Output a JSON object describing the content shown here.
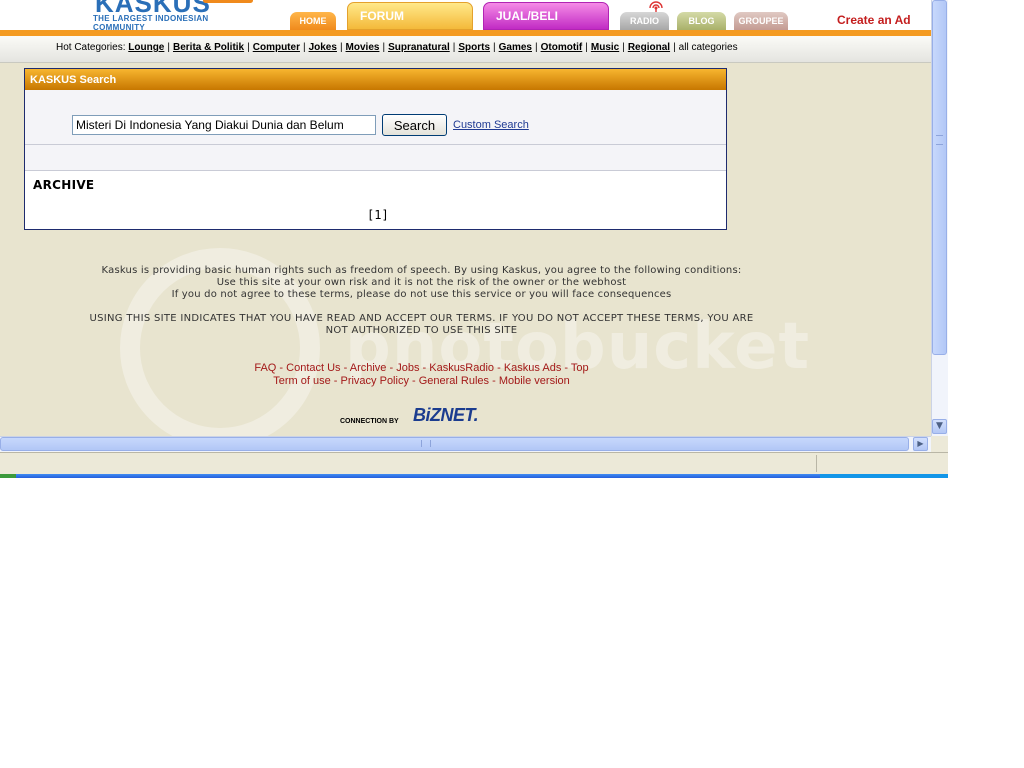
{
  "header": {
    "logo_text": "KASKUS",
    "logo_tagline": "THE LARGEST INDONESIAN COMMUNITY",
    "tabs": [
      {
        "label": "HOME"
      },
      {
        "label": "FORUM"
      },
      {
        "label": "JUAL/BELI"
      },
      {
        "label": "RADIO"
      },
      {
        "label": "BLOG"
      },
      {
        "label": "GROUPEE"
      }
    ],
    "create_ad": "Create an Ad"
  },
  "hot_categories": {
    "label": "Hot Categories:",
    "items": [
      "Lounge",
      "Berita & Politik",
      "Computer",
      "Jokes",
      "Movies",
      "Supranatural",
      "Sports",
      "Games",
      "Otomotif",
      "Music",
      "Regional"
    ],
    "all_label": "all categories"
  },
  "search": {
    "title": "KASKUS Search",
    "query_value": "Misteri Di Indonesia Yang Diakui Dunia dan Belum",
    "button_label": "Search",
    "custom_link": "Custom Search",
    "section_heading": "ARCHIVE",
    "pagination": "[1]"
  },
  "footer": {
    "disclaimer_lines": [
      "Kaskus is providing basic human rights such as freedom of speech. By using Kaskus, you agree to the following conditions:",
      "Use this site at your own risk and it is not the risk of the owner or the webhost",
      "If you do not agree to these terms, please do not use this service or you will face consequences"
    ],
    "terms_lines": [
      "USING THIS SITE INDICATES THAT YOU HAVE READ AND ACCEPT OUR TERMS. IF YOU DO NOT ACCEPT THESE TERMS, YOU ARE",
      "NOT AUTHORIZED TO USE THIS SITE"
    ],
    "links_row1": [
      "FAQ",
      "Contact Us",
      "Archive",
      "Jobs",
      "KaskusRadio",
      "Kaskus Ads",
      "Top"
    ],
    "links_row2": [
      "Term of use",
      "Privacy Policy",
      "General Rules",
      "Mobile version"
    ],
    "connection_label": "CONNECTION BY",
    "connection_brand": "BiZNET."
  },
  "watermark": {
    "text": "photobucket"
  },
  "colors": {
    "brand_orange": "#F49B21",
    "panel_border": "#1E2B6E",
    "link_red": "#A31919",
    "page_bg": "#E8E4CF"
  }
}
